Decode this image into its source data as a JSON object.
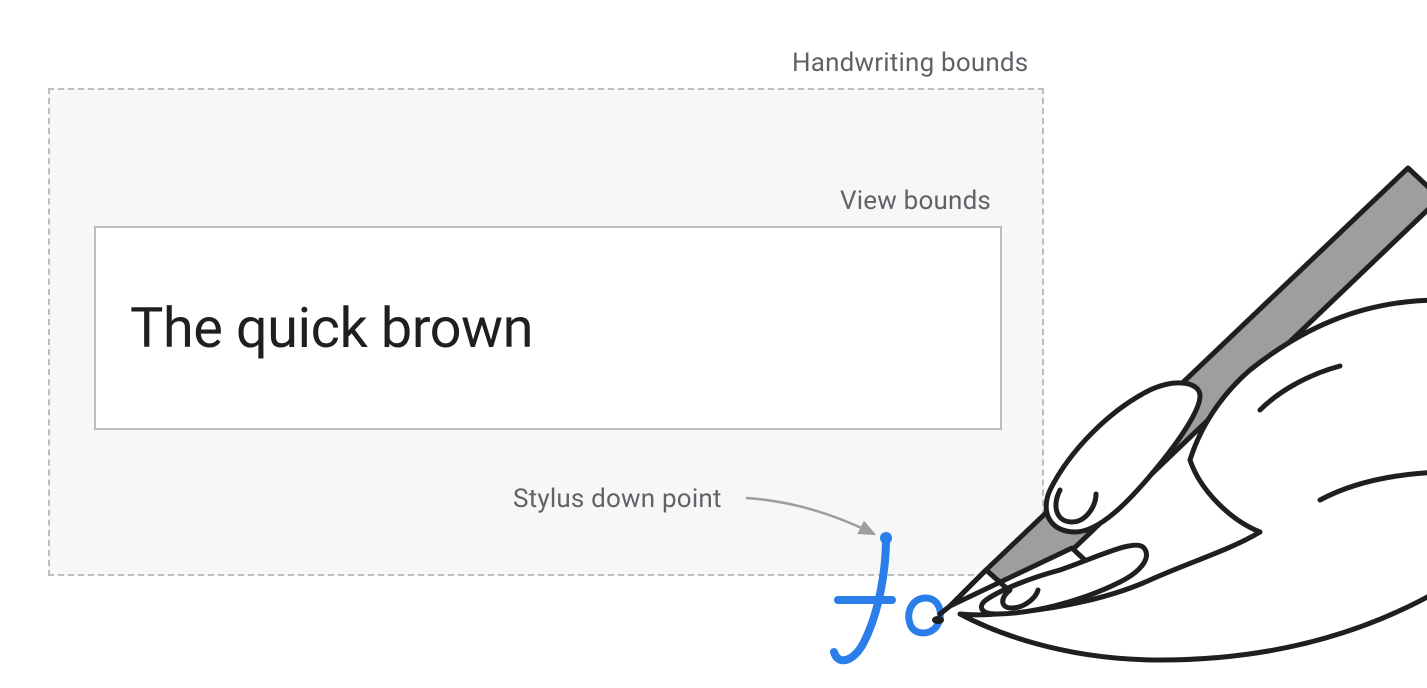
{
  "labels": {
    "handwriting_bounds": "Handwriting bounds",
    "view_bounds": "View bounds",
    "stylus_down_point": "Stylus down point"
  },
  "text_input": {
    "value": "The quick brown"
  },
  "ink": {
    "glyphs": "fo",
    "color": "#2b7de9"
  },
  "colors": {
    "label": "#5f6368",
    "border": "#bdbdbd",
    "bounds_fill": "#f7f7f7",
    "ink": "#2b7de9",
    "stylus_fill": "#9e9e9e"
  }
}
